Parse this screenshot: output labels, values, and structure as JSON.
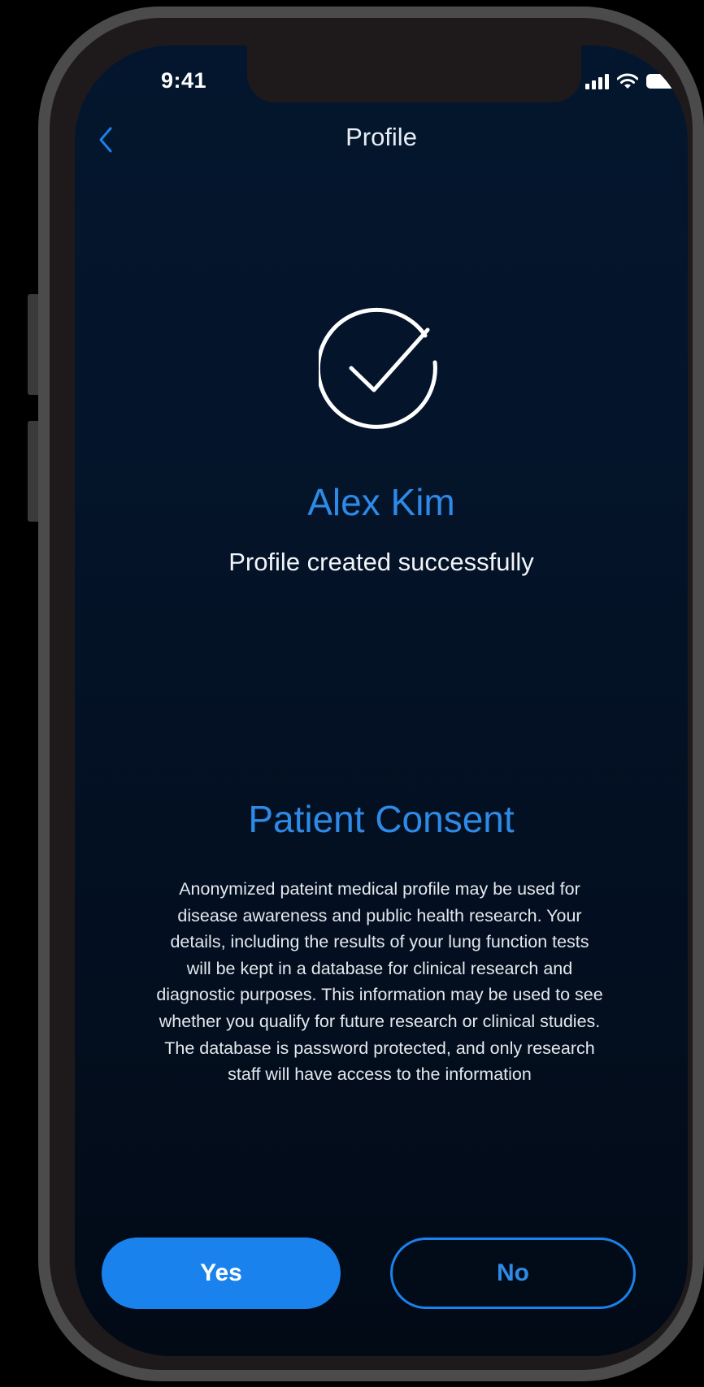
{
  "status_bar": {
    "time": "9:41"
  },
  "nav": {
    "title": "Profile"
  },
  "profile": {
    "name": "Alex Kim",
    "message": "Profile created successfully"
  },
  "consent": {
    "title": "Patient Consent",
    "body": "Anonymized pateint medical profile may be used for disease awareness and public health research. Your details, including the results of your lung function tests will be kept in a database for clinical research and diagnostic purposes. This information may be used to see whether you qualify for future research or clinical studies. The database is password protected, and only research staff will have access to the information"
  },
  "actions": {
    "yes_label": "Yes",
    "no_label": "No"
  },
  "colors": {
    "accent": "#1a82ec",
    "accent_text": "#2d8ae6",
    "background": "#03162d"
  },
  "icons": [
    "back-chevron-icon",
    "checkmark-circle-icon",
    "signal-icon",
    "wifi-icon",
    "battery-icon"
  ]
}
